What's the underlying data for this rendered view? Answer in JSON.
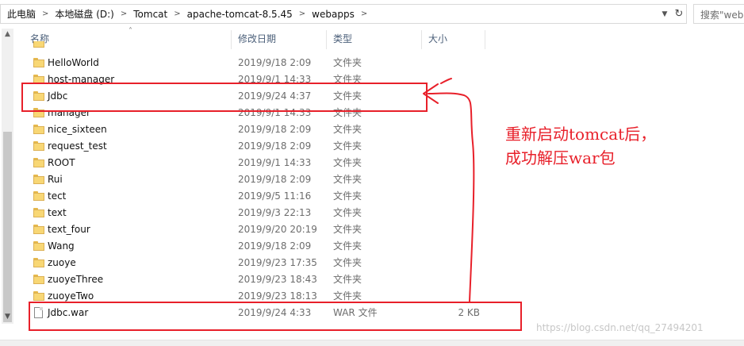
{
  "addressbar": {
    "crumbs": [
      "此电脑",
      "本地磁盘 (D:)",
      "Tomcat",
      "apache-tomcat-8.5.45",
      "webapps"
    ],
    "search_placeholder": "搜索\"web"
  },
  "list": {
    "headers": {
      "name": "名称",
      "date": "修改日期",
      "type": "类型",
      "size": "大小"
    },
    "rows": [
      {
        "name": "HelloWorld",
        "date": "2019/9/18 2:09",
        "type": "文件夹",
        "size": "",
        "icon": "folder-icon"
      },
      {
        "name": "host-manager",
        "date": "2019/9/1 14:33",
        "type": "文件夹",
        "size": "",
        "icon": "folder-icon"
      },
      {
        "name": "Jdbc",
        "date": "2019/9/24 4:37",
        "type": "文件夹",
        "size": "",
        "icon": "folder-icon"
      },
      {
        "name": "manager",
        "date": "2019/9/1 14:33",
        "type": "文件夹",
        "size": "",
        "icon": "folder-icon"
      },
      {
        "name": "nice_sixteen",
        "date": "2019/9/18 2:09",
        "type": "文件夹",
        "size": "",
        "icon": "folder-icon"
      },
      {
        "name": "request_test",
        "date": "2019/9/18 2:09",
        "type": "文件夹",
        "size": "",
        "icon": "folder-icon"
      },
      {
        "name": "ROOT",
        "date": "2019/9/1 14:33",
        "type": "文件夹",
        "size": "",
        "icon": "folder-icon"
      },
      {
        "name": "Rui",
        "date": "2019/9/18 2:09",
        "type": "文件夹",
        "size": "",
        "icon": "folder-icon"
      },
      {
        "name": "tect",
        "date": "2019/9/5 11:16",
        "type": "文件夹",
        "size": "",
        "icon": "folder-icon"
      },
      {
        "name": "text",
        "date": "2019/9/3 22:13",
        "type": "文件夹",
        "size": "",
        "icon": "folder-icon"
      },
      {
        "name": "text_four",
        "date": "2019/9/20 20:19",
        "type": "文件夹",
        "size": "",
        "icon": "folder-icon"
      },
      {
        "name": "Wang",
        "date": "2019/9/18 2:09",
        "type": "文件夹",
        "size": "",
        "icon": "folder-icon"
      },
      {
        "name": "zuoye",
        "date": "2019/9/23 17:35",
        "type": "文件夹",
        "size": "",
        "icon": "folder-icon"
      },
      {
        "name": "zuoyeThree",
        "date": "2019/9/23 18:43",
        "type": "文件夹",
        "size": "",
        "icon": "folder-icon"
      },
      {
        "name": "zuoyeTwo",
        "date": "2019/9/23 18:13",
        "type": "文件夹",
        "size": "",
        "icon": "folder-icon"
      },
      {
        "name": "Jdbc.war",
        "date": "2019/9/24 4:33",
        "type": "WAR 文件",
        "size": "2 KB",
        "icon": "file-icon"
      }
    ]
  },
  "annotation": {
    "line1": "重新启动tomcat后，",
    "line2": "成功解压war包",
    "color": "#e8202a"
  },
  "watermark": "https://blog.csdn.net/qq_27494201"
}
